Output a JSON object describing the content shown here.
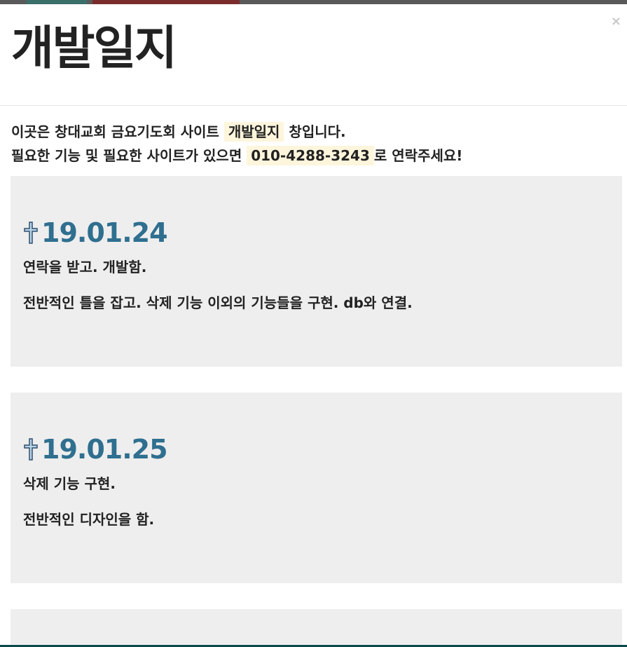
{
  "modal": {
    "close_label": "×",
    "title": "개발일지"
  },
  "intro": {
    "line1_before": "이곳은 창대교회 금요기도회 사이트 ",
    "line1_highlight": "개발일지",
    "line1_after": " 창입니다.",
    "line2_before": "필요한 기능 및 필요한 사이트가 있으면 ",
    "line2_highlight": "010-4288-3243",
    "line2_after": "로 연락주세요!"
  },
  "entries": [
    {
      "date": "19.01.24",
      "lines": [
        "연락을 받고. 개발함.",
        "전반적인 틀을 잡고. 삭제 기능 이외의 기능들을 구현. db와 연결."
      ]
    },
    {
      "date": "19.01.25",
      "lines": [
        "삭제 기능 구현.",
        "전반적인 디자인을 함."
      ]
    }
  ],
  "colors": {
    "date": "#2f6f8f",
    "entry_bg": "#eeeeee",
    "highlight_bg": "#fdf5dc",
    "title": "#222222"
  },
  "icons": {
    "entry_marker": "cross-icon",
    "close": "close-icon"
  }
}
